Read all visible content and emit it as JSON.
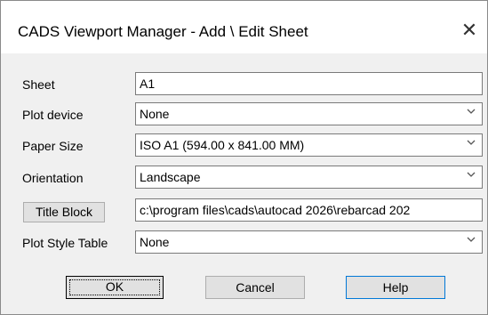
{
  "window": {
    "title": "CADS Viewport Manager - Add \\ Edit Sheet",
    "close_glyph": "✕"
  },
  "rows": {
    "sheet": {
      "label": "Sheet",
      "value": "A1"
    },
    "plot_device": {
      "label": "Plot device",
      "value": "None"
    },
    "paper_size": {
      "label": "Paper Size",
      "value": "ISO A1 (594.00 x 841.00 MM)"
    },
    "orientation": {
      "label": "Orientation",
      "value": "Landscape"
    },
    "title_block": {
      "button_label": "Title Block",
      "value": "c:\\program files\\cads\\autocad 2026\\rebarcad 202"
    },
    "plot_style_table": {
      "label": "Plot Style Table",
      "value": "None"
    }
  },
  "buttons": {
    "ok": "OK",
    "cancel": "Cancel",
    "help": "Help"
  },
  "icons": {
    "dropdown": "chevron-down-icon",
    "close": "close-icon"
  },
  "colors": {
    "help_border": "#0078d7"
  }
}
